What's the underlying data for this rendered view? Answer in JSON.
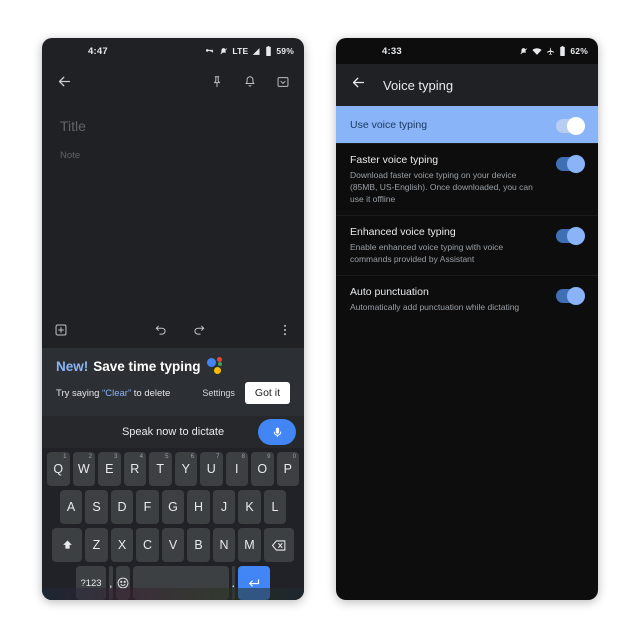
{
  "left_phone": {
    "status": {
      "time": "4:47",
      "icons": [
        "vpn-key-icon",
        "bell-muted-icon"
      ],
      "network": "LTE",
      "signal_icon": "signal-bars-icon",
      "battery_icon": "battery-icon",
      "battery": "59%"
    },
    "appbar": {
      "back_icon": "back-arrow-icon",
      "pin_icon": "pin-icon",
      "reminder_icon": "bell-icon",
      "archive_icon": "archive-icon"
    },
    "note": {
      "title_placeholder": "Title",
      "body_placeholder": "Note"
    },
    "bottombar": {
      "add_icon": "add-box-icon",
      "undo_icon": "undo-icon",
      "redo_icon": "redo-icon",
      "more_icon": "more-vert-icon"
    },
    "promo": {
      "badge": "New!",
      "headline": "Save time typing",
      "assistant_icon": "google-assistant-dots-icon",
      "sub_prefix": "Try saying ",
      "sub_keyword": "“Clear”",
      "sub_suffix": " to delete",
      "settings_label": "Settings",
      "gotit_label": "Got it"
    },
    "dictation": {
      "prompt": "Speak now to dictate",
      "mic_icon": "microphone-icon"
    },
    "keyboard": {
      "row1": [
        {
          "key": "Q",
          "num": "1"
        },
        {
          "key": "W",
          "num": "2"
        },
        {
          "key": "E",
          "num": "3"
        },
        {
          "key": "R",
          "num": "4"
        },
        {
          "key": "T",
          "num": "5"
        },
        {
          "key": "Y",
          "num": "6"
        },
        {
          "key": "U",
          "num": "7"
        },
        {
          "key": "I",
          "num": "8"
        },
        {
          "key": "O",
          "num": "9"
        },
        {
          "key": "P",
          "num": "0"
        }
      ],
      "row2": [
        "A",
        "S",
        "D",
        "F",
        "G",
        "H",
        "J",
        "K",
        "L"
      ],
      "row3": [
        "Z",
        "X",
        "C",
        "V",
        "B",
        "N",
        "M"
      ],
      "shift_icon": "shift-icon",
      "backspace_icon": "backspace-icon",
      "symbols_label": "?123",
      "comma_label": ",",
      "emoji_icon": "emoji-icon",
      "space_label": "",
      "period_label": ".",
      "enter_icon": "enter-icon"
    }
  },
  "right_phone": {
    "status": {
      "time": "4:33",
      "bell_muted_icon": "bell-muted-icon",
      "wifi_icon": "wifi-icon",
      "airplane_icon": "airplane-mode-icon",
      "battery_icon": "battery-icon",
      "battery": "62%"
    },
    "appbar": {
      "back_icon": "back-arrow-icon",
      "title": "Voice typing"
    },
    "settings": [
      {
        "title": "Use voice typing",
        "subtitle": "",
        "toggle": "on",
        "highlighted": true
      },
      {
        "title": "Faster voice typing",
        "subtitle": "Download faster voice typing on your device (85MB, US-English). Once downloaded, you can use it offline",
        "toggle": "on",
        "highlighted": false
      },
      {
        "title": "Enhanced voice typing",
        "subtitle": "Enable enhanced voice typing with voice commands provided by Assistant",
        "toggle": "on",
        "highlighted": false
      },
      {
        "title": "Auto punctuation",
        "subtitle": "Automatically add punctuation while dictating",
        "toggle": "on",
        "highlighted": false
      }
    ]
  },
  "colors": {
    "accent_blue": "#8ab4f8",
    "google_blue": "#4285f4",
    "dark_bg": "#202124",
    "keyboard_bg": "#212227"
  }
}
